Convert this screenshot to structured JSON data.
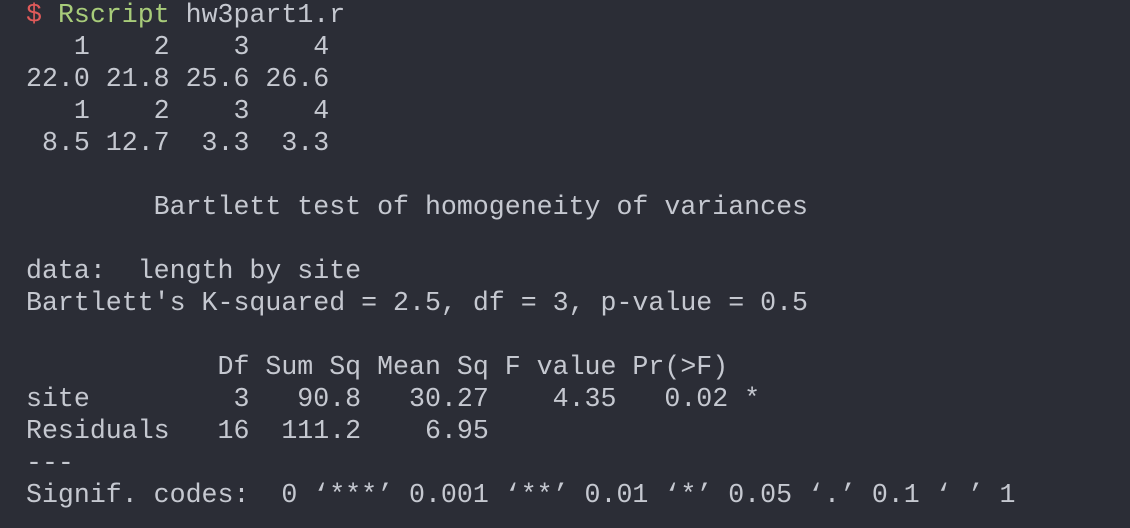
{
  "terminal": {
    "prompt_symbol": "$",
    "command": "Rscript",
    "argument": "hw3part1.r",
    "output_lines": [
      "   1    2    3    4",
      "22.0 21.8 25.6 26.6",
      "   1    2    3    4",
      " 8.5 12.7  3.3  3.3",
      "",
      "        Bartlett test of homogeneity of variances",
      "",
      "data:  length by site",
      "Bartlett's K-squared = 2.5, df = 3, p-value = 0.5",
      "",
      "            Df Sum Sq Mean Sq F value Pr(>F)  ",
      "site         3   90.8   30.27    4.35   0.02 *",
      "Residuals   16  111.2    6.95                ",
      "---",
      "Signif. codes:  0 ‘***’ 0.001 ‘**’ 0.01 ‘*’ 0.05 ‘.’ 0.1 ‘ ’ 1"
    ]
  },
  "colors": {
    "background": "#2b2d36",
    "text": "#c5c8d0",
    "prompt": "#e05a5a",
    "command": "#a8cc7a"
  }
}
